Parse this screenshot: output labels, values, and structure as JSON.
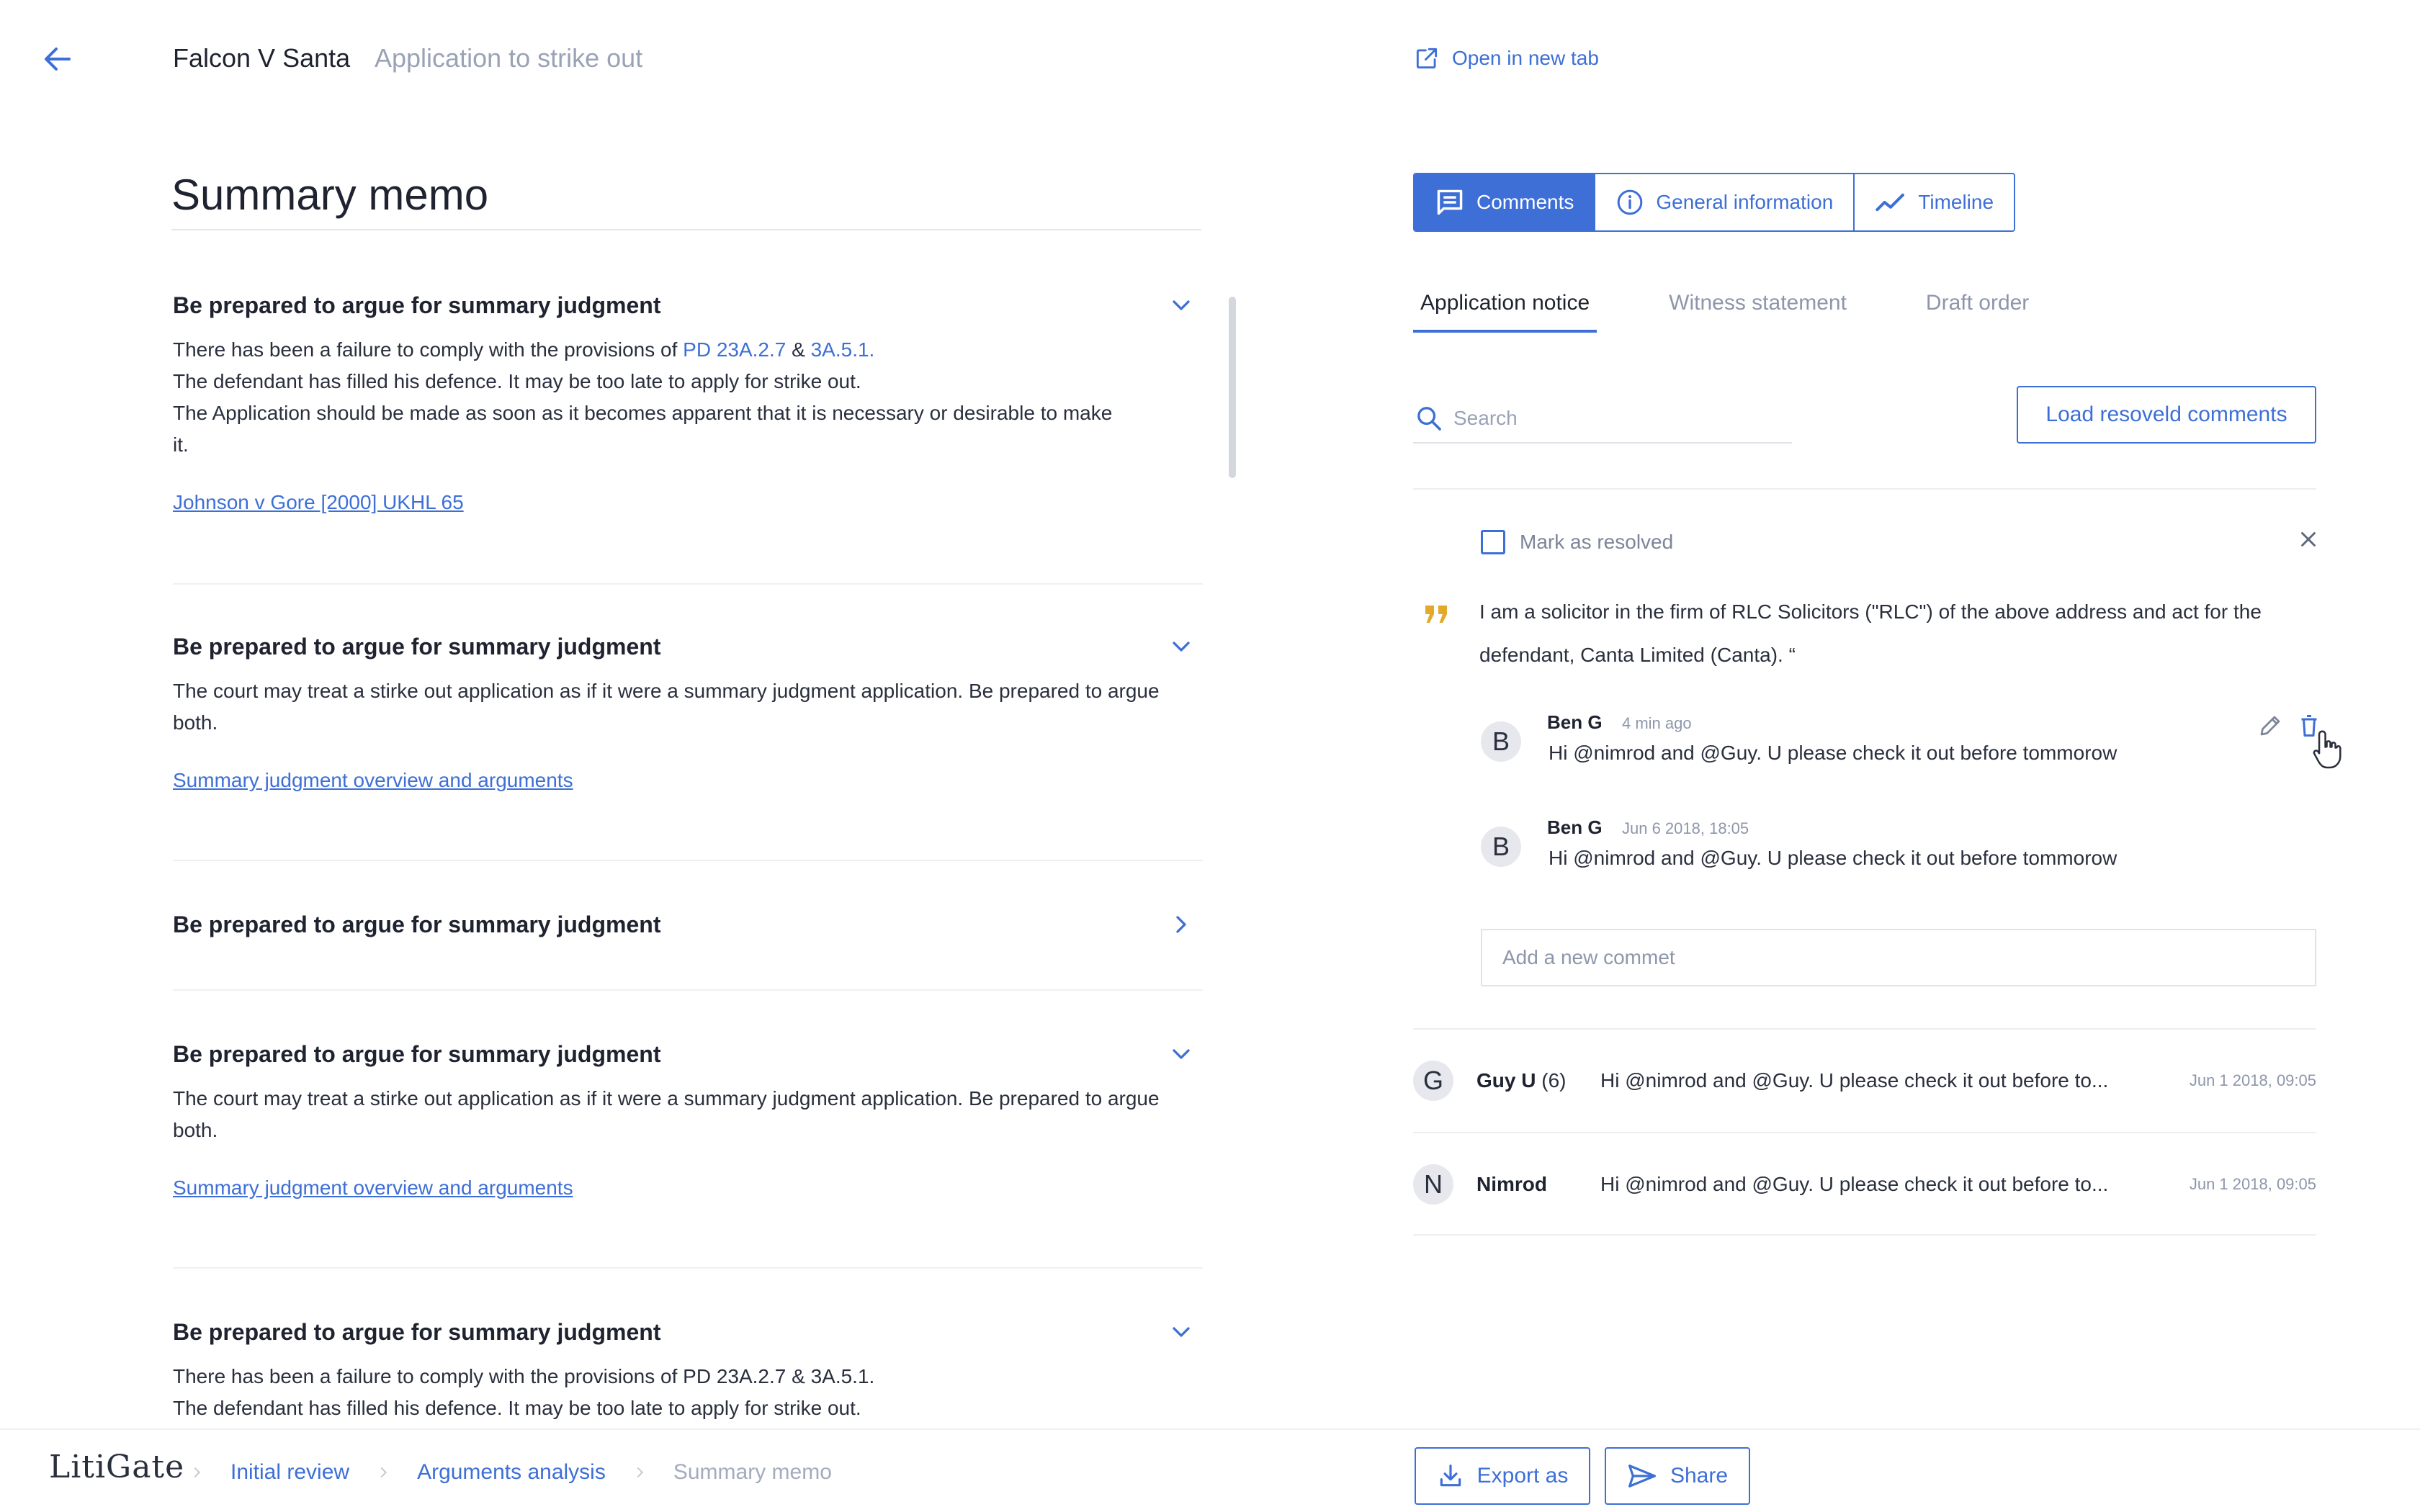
{
  "header": {
    "case_title": "Falcon V Santa",
    "case_subtitle": "Application to strike out",
    "open_new_tab": "Open in new tab"
  },
  "memo": {
    "title": "Summary memo",
    "sections": [
      {
        "title": "Be prepared to argue for summary judgment",
        "expanded": true,
        "body_line1_prefix": "There has been a failure to comply with the provisions of ",
        "ref1": "PD 23A.2.7",
        "amp": " & ",
        "ref2": "3A.5.1.",
        "body_line2": "The defendant has filled his defence. It may be too late to apply for strike out.",
        "body_line3": "The Application should be made as soon as it becomes apparent that it is necessary or desirable to make it.",
        "link": "Johnson v Gore [2000] UKHL 65"
      },
      {
        "title": "Be prepared to argue for summary judgment",
        "expanded": true,
        "body": "The court may treat a stirke out application as if it were a summary judgment application. Be prepared to argue both.",
        "link": "Summary judgment overview and arguments"
      },
      {
        "title": "Be prepared to argue for summary judgment",
        "expanded": false
      },
      {
        "title": "Be prepared to argue for summary judgment",
        "expanded": true,
        "body": "The court may treat a stirke out application as if it were a summary judgment application. Be prepared to argue both.",
        "link": "Summary judgment overview and arguments"
      },
      {
        "title": "Be prepared to argue for summary judgment",
        "expanded": true,
        "body_line1": "There has been a failure to comply with the provisions of PD 23A.2.7 & 3A.5.1.",
        "body_line2": "The defendant has filled his defence. It may be too late to apply for strike out."
      }
    ]
  },
  "panel": {
    "segments": [
      {
        "label": "Comments",
        "icon": "comment-icon",
        "active": true
      },
      {
        "label": "General information",
        "icon": "info-icon",
        "active": false
      },
      {
        "label": "Timeline",
        "icon": "trend-icon",
        "active": false
      }
    ],
    "tabs": [
      {
        "label": "Application notice",
        "active": true
      },
      {
        "label": "Witness statement",
        "active": false
      },
      {
        "label": "Draft order",
        "active": false
      }
    ],
    "search_placeholder": "Search",
    "load_resolved": "Load resoveld comments",
    "mark_resolved": "Mark as resolved",
    "quote": "I am a solicitor in the firm of RLC Solicitors (\"RLC\") of the above address and act for the defendant, Canta Limited (Canta). “",
    "comments": [
      {
        "initial": "B",
        "author": "Ben G",
        "time": "4 min ago",
        "text": "Hi @nimrod and @Guy. U please check it out before tommorow"
      },
      {
        "initial": "B",
        "author": "Ben G",
        "time": "Jun 6 2018, 18:05",
        "text": "Hi @nimrod and @Guy. U please check it out before tommorow"
      }
    ],
    "new_comment_placeholder": "Add a new commet",
    "threads": [
      {
        "initial": "G",
        "author": "Guy U",
        "count": "(6)",
        "text": "Hi @nimrod and @Guy. U please check it out before to...",
        "date": "Jun 1 2018, 09:05"
      },
      {
        "initial": "N",
        "author": "Nimrod",
        "count": "",
        "text": "Hi @nimrod and @Guy. U please check it out before to...",
        "date": "Jun 1 2018, 09:05"
      }
    ]
  },
  "footer": {
    "logo": "LitiGate",
    "breadcrumbs": [
      "Initial review",
      "Arguments analysis",
      "Summary memo"
    ],
    "export_label": "Export as",
    "share_label": "Share"
  },
  "colors": {
    "accent": "#3d6fd6",
    "quote_mark": "#e2a92a"
  }
}
